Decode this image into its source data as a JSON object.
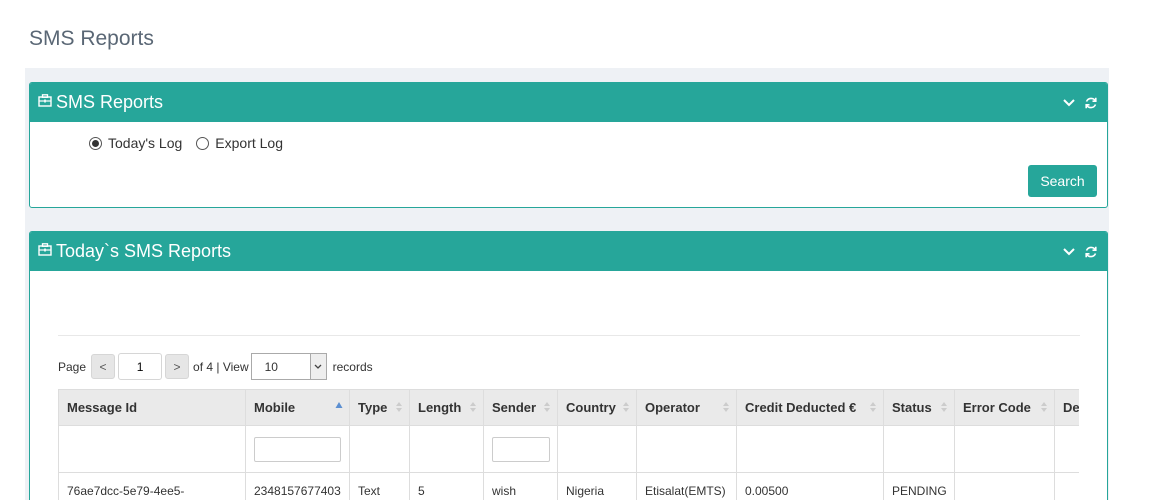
{
  "page": {
    "title": "SMS Reports"
  },
  "panel1": {
    "title": "SMS Reports",
    "options": [
      {
        "label": "Today's Log",
        "selected": true
      },
      {
        "label": "Export Log",
        "selected": false
      }
    ],
    "search_label": "Search"
  },
  "panel2": {
    "title": "Today`s SMS Reports",
    "pager": {
      "page_label": "Page",
      "prev": "<",
      "current_page": "1",
      "next": ">",
      "of_text": "of 4 | View",
      "page_size": "10",
      "records_label": "records"
    },
    "table": {
      "columns": [
        "Message Id",
        "Mobile",
        "Type",
        "Length",
        "Sender",
        "Country",
        "Operator",
        "Credit Deducted €",
        "Status",
        "Error Code",
        "De"
      ],
      "rows": [
        [
          "76ae7dcc-5e79-4ee5-",
          "2348157677403",
          "Text",
          "5",
          "wish",
          "Nigeria",
          "Etisalat(EMTS)",
          "0.00500",
          "PENDING",
          "",
          ""
        ]
      ]
    }
  },
  "colors": {
    "accent": "#26a69a",
    "title": "#5a6775",
    "background": "#eef1f5"
  },
  "icons": [
    "briefcase-icon",
    "chevron-down-icon",
    "refresh-icon",
    "sort-icon"
  ]
}
